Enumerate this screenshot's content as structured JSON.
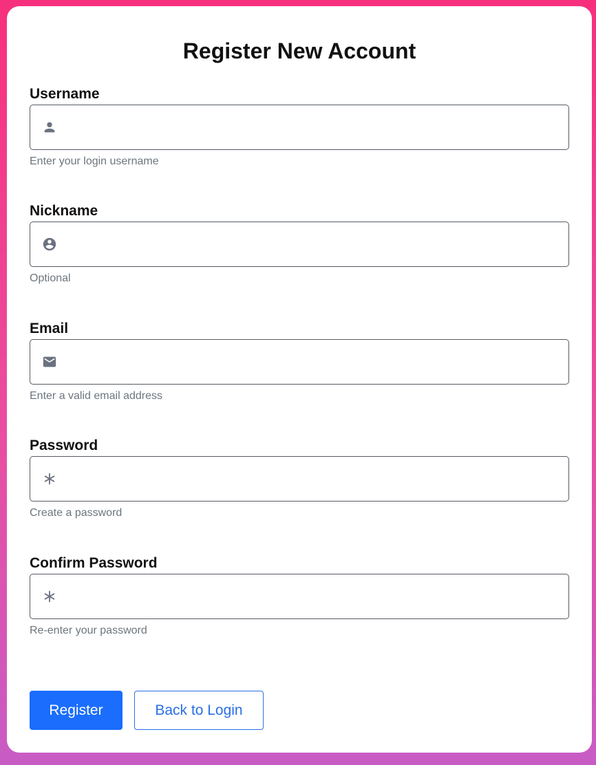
{
  "form": {
    "title": "Register New Account",
    "fields": [
      {
        "label": "Username",
        "icon": "person-icon",
        "value": "",
        "help": "Enter your login username"
      },
      {
        "label": "Nickname",
        "icon": "account-circle-icon",
        "value": "",
        "help": "Optional"
      },
      {
        "label": "Email",
        "icon": "envelope-icon",
        "value": "",
        "help": "Enter a valid email address"
      },
      {
        "label": "Password",
        "icon": "asterisk-icon",
        "value": "",
        "help": "Create a password"
      },
      {
        "label": "Confirm Password",
        "icon": "asterisk-icon",
        "value": "",
        "help": "Re-enter your password"
      }
    ],
    "buttons": {
      "register_label": "Register",
      "back_label": "Back to Login"
    }
  },
  "colors": {
    "primary": "#1a6dfd",
    "icon": "#6b7280",
    "help_text": "#6c757d",
    "background_gradient_top": "#f7307d",
    "background_gradient_bottom": "#c85cc5"
  }
}
